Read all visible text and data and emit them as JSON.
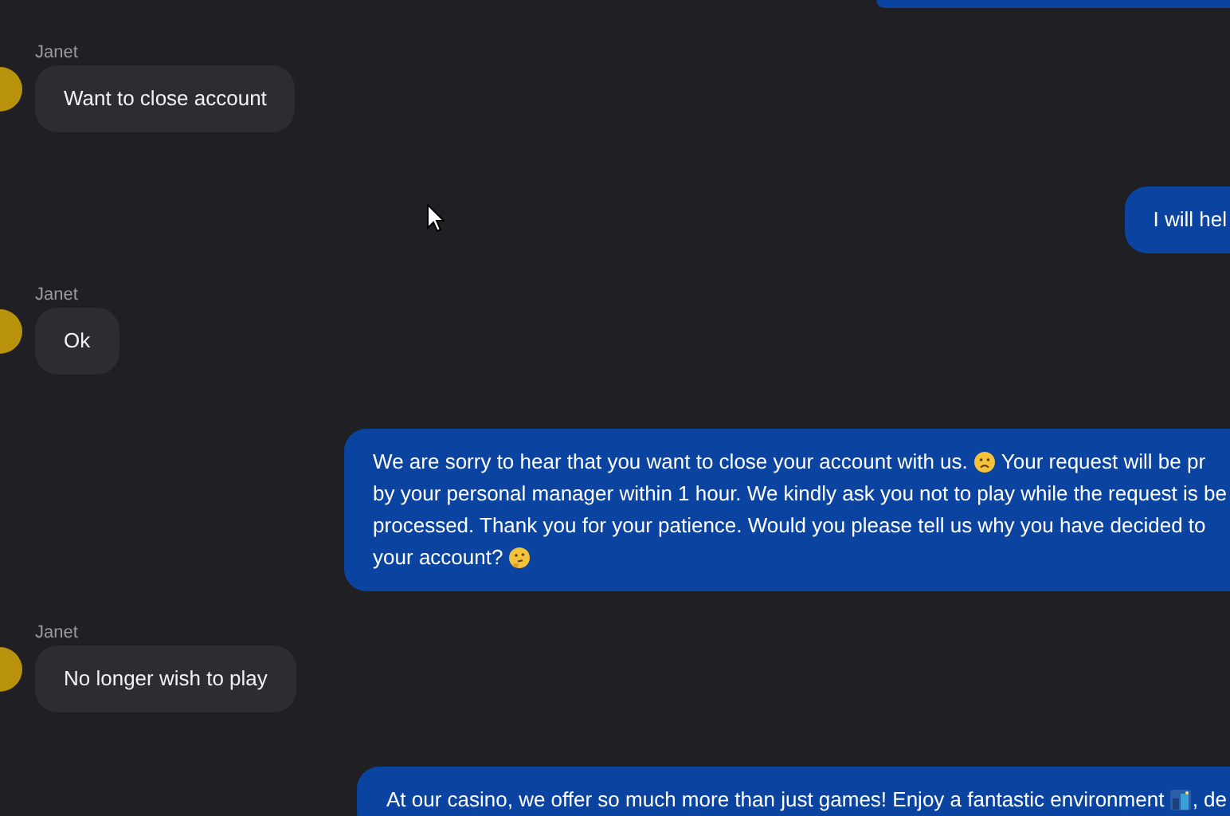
{
  "messages": [
    {
      "kind": "incoming",
      "sender": "Janet",
      "lines": [
        [
          {
            "kind": "text",
            "text": "Want to close account"
          }
        ]
      ]
    },
    {
      "kind": "outgoing",
      "lines": [
        [
          {
            "kind": "text",
            "text": "I will hel"
          }
        ]
      ]
    },
    {
      "kind": "incoming",
      "sender": "Janet",
      "lines": [
        [
          {
            "kind": "text",
            "text": "Ok"
          }
        ]
      ]
    },
    {
      "kind": "outgoing",
      "lines": [
        [
          {
            "kind": "text",
            "text": "We are sorry to hear that you want to close your account with us. "
          },
          {
            "kind": "frown"
          },
          {
            "kind": "text",
            "text": " Your request will be pr"
          }
        ],
        [
          {
            "kind": "text",
            "text": "by your personal manager within 1 hour. We kindly ask you not to play while the request is be"
          }
        ],
        [
          {
            "kind": "text",
            "text": "processed. Thank you for your patience. Would you please tell us why you have decided to"
          }
        ],
        [
          {
            "kind": "text",
            "text": "your account? "
          },
          {
            "kind": "thinking"
          }
        ]
      ]
    },
    {
      "kind": "incoming",
      "sender": "Janet",
      "lines": [
        [
          {
            "kind": "text",
            "text": "No longer wish to play"
          }
        ]
      ]
    },
    {
      "kind": "outgoing",
      "lines": [
        [
          {
            "kind": "text",
            "text": "At our casino, we offer so much more than just games! Enjoy a fantastic environment "
          },
          {
            "kind": "city"
          },
          {
            "kind": "text",
            "text": ", de"
          }
        ]
      ]
    }
  ]
}
